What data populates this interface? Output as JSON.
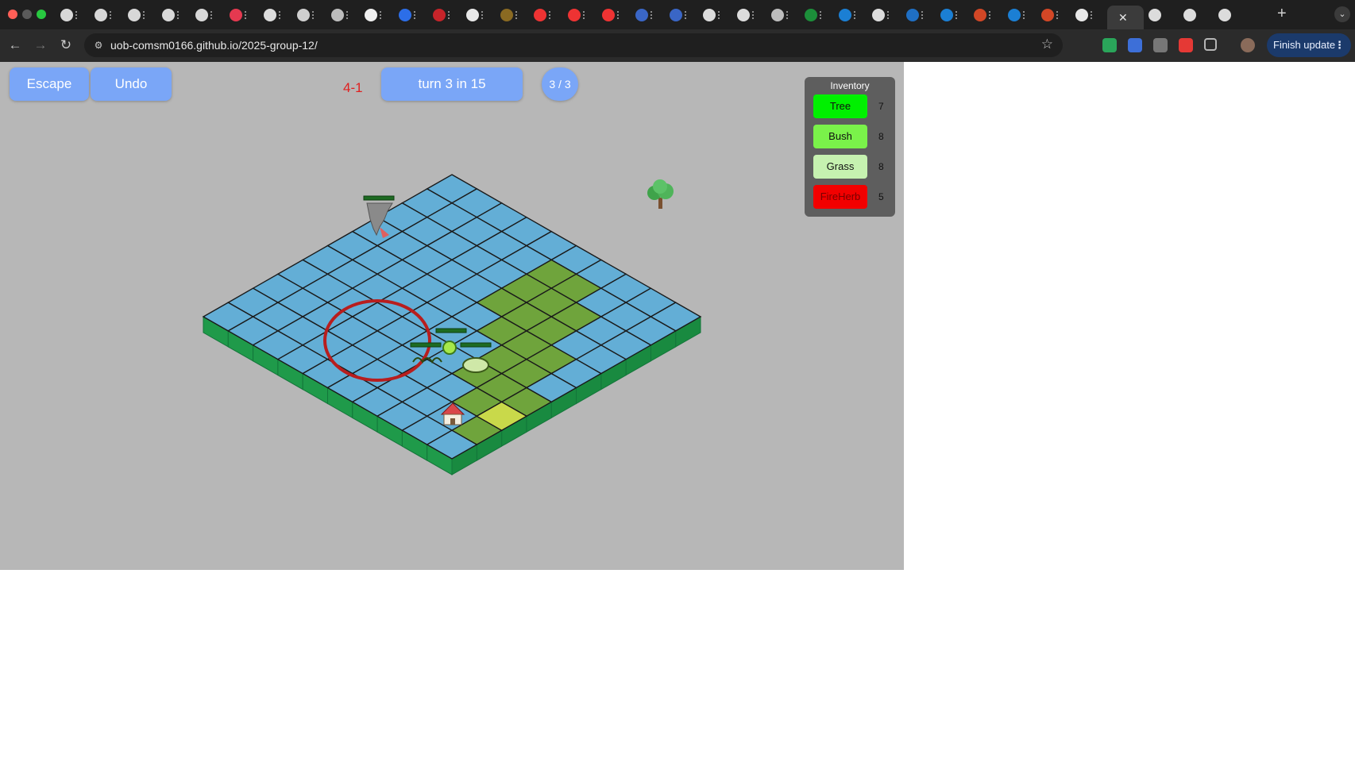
{
  "browser": {
    "tabs": [
      {
        "icon": "chrome-tab-icon"
      },
      {
        "icon": "chrome-tab-icon"
      },
      {
        "icon": "chrome-tab-icon"
      },
      {
        "icon": "chrome-tab-icon"
      },
      {
        "icon": "chrome-tab-icon"
      },
      {
        "icon": "record-tab-icon"
      },
      {
        "icon": "github-tab-icon"
      },
      {
        "icon": "openai-tab-icon"
      },
      {
        "icon": "globe-tab-icon"
      },
      {
        "icon": "medium-tab-icon"
      },
      {
        "icon": "c-tab-icon"
      },
      {
        "icon": "met-tab-icon"
      },
      {
        "icon": "doc-tab-icon"
      },
      {
        "icon": "js-tab-icon"
      },
      {
        "icon": "youtube-tab-icon"
      },
      {
        "icon": "youtube-tab-icon"
      },
      {
        "icon": "youtube-tab-icon"
      },
      {
        "icon": "word-tab-icon"
      },
      {
        "icon": "word-tab-icon"
      },
      {
        "icon": "github-tab-icon"
      },
      {
        "icon": "github-tab-icon"
      },
      {
        "icon": "globe-tab-icon"
      },
      {
        "icon": "w-tab-icon"
      },
      {
        "icon": "a-tab-icon"
      },
      {
        "icon": "github-tab-icon"
      },
      {
        "icon": "outlook-tab-icon"
      },
      {
        "icon": "a-tab-icon"
      },
      {
        "icon": "powerpoint-tab-icon"
      },
      {
        "icon": "a-tab-icon"
      },
      {
        "icon": "powerpoint-tab-icon"
      },
      {
        "icon": "font-tab-icon"
      }
    ],
    "url": "uob-comsm0166.github.io/2025-group-12/",
    "finish_update_label": "Finish update"
  },
  "game": {
    "escape_label": "Escape",
    "undo_label": "Undo",
    "level_label": "4-1",
    "turn_label": "turn 3 in 15",
    "progress_label": "3 / 3",
    "inventory": {
      "title": "Inventory",
      "items": [
        {
          "name": "Tree",
          "count": "7",
          "color": "#00f000"
        },
        {
          "name": "Bush",
          "count": "8",
          "color": "#7af24a"
        },
        {
          "name": "Grass",
          "count": "8",
          "color": "#c6f2b0"
        },
        {
          "name": "FireHerb",
          "count": "5",
          "color": "#f20000"
        }
      ]
    },
    "colors": {
      "background": "#b7b7b7",
      "water": "#63aed6",
      "grass": "#6fa43c",
      "side": "#1f9a4a",
      "selection_ring": "#b81e1e"
    }
  }
}
